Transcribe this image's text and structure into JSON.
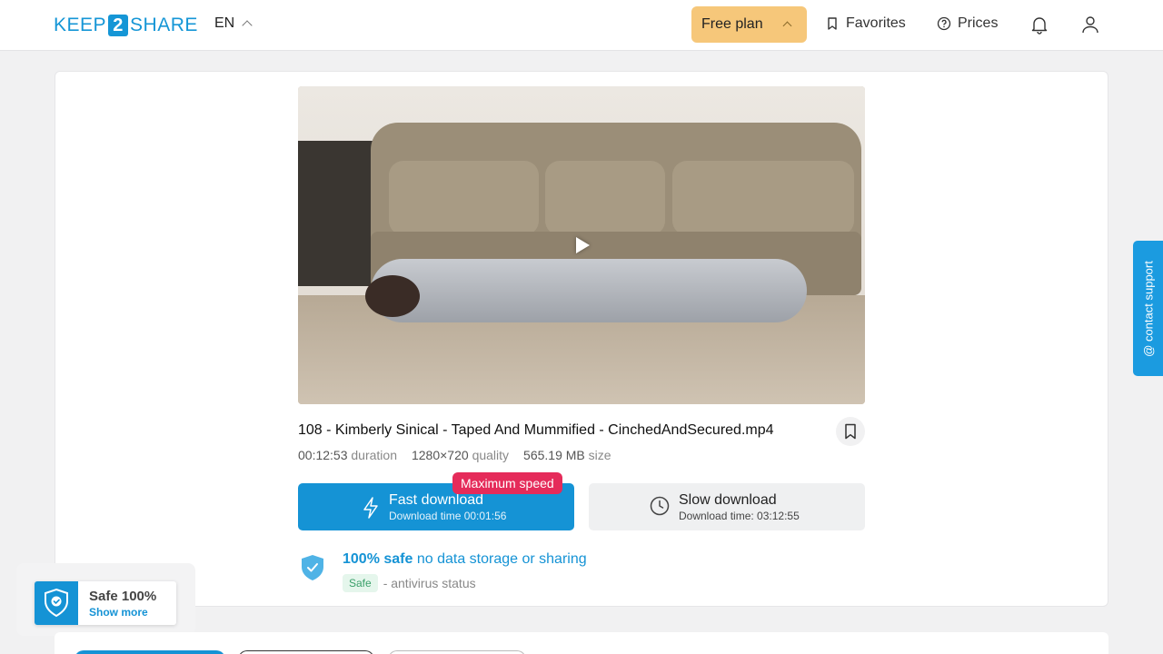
{
  "header": {
    "logo": {
      "left": "KEEP",
      "num": "2",
      "right": "SHARE"
    },
    "lang": "EN",
    "plan_label": "Free plan",
    "favorites_label": "Favorites",
    "prices_label": "Prices"
  },
  "file": {
    "title": "108 - Kimberly Sinical - Taped And Mummified - CinchedAndSecured.mp4",
    "duration_value": "00:12:53",
    "duration_label": "duration",
    "quality_value": "1280×720",
    "quality_label": "quality",
    "size_value": "565.19 MB",
    "size_label": "size"
  },
  "download": {
    "badge": "Maximum speed",
    "fast_title": "Fast download",
    "fast_sub": "Download time 00:01:56",
    "slow_title": "Slow download",
    "slow_sub": "Download time: 03:12:55"
  },
  "safety": {
    "bold": "100% safe",
    "rest": "no data storage or sharing",
    "av_badge": "Safe",
    "av_text": "- antivirus status"
  },
  "support_label": "@ contact support",
  "safe_widget": {
    "title": "Safe 100%",
    "link": "Show more"
  },
  "colors": {
    "accent": "#1593d5",
    "plan": "#f6c77a",
    "badge": "#e52b5a"
  }
}
